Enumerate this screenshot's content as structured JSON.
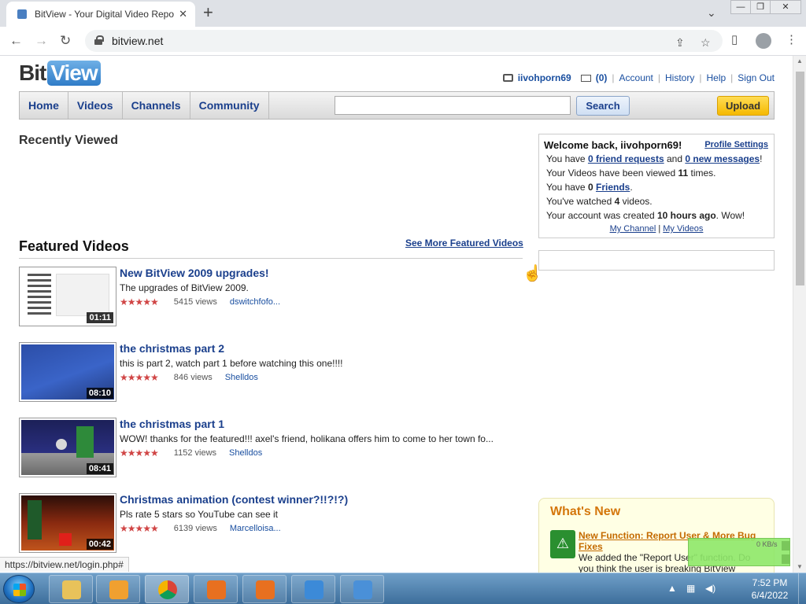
{
  "browser": {
    "tab_title": "BitView - Your Digital Video Repository",
    "url": "bitview.net",
    "status_url": "https://bitview.net/login.php#"
  },
  "site": {
    "logo_bit": "Bit",
    "logo_view": "View",
    "username": "iivohporn69",
    "message_count": "(0)",
    "user_links": [
      "Account",
      "History",
      "Help",
      "Sign Out"
    ],
    "nav": [
      "Home",
      "Videos",
      "Channels",
      "Community"
    ],
    "search_label": "Search",
    "upload_label": "Upload"
  },
  "recently_viewed": {
    "heading": "Recently Viewed"
  },
  "featured": {
    "heading": "Featured Videos",
    "see_more": "See More Featured Videos",
    "videos": [
      {
        "title": "New BitView 2009 upgrades!",
        "description": "The upgrades of BitView 2009.",
        "views": "5415 views",
        "author": "dswitchfofo...",
        "duration": "01:11",
        "rating": 4.5
      },
      {
        "title": "the christmas part 2",
        "description": "this is part 2, watch part 1 before watching this one!!!!",
        "views": "846 views",
        "author": "Shelldos",
        "duration": "08:10",
        "rating": 4.5
      },
      {
        "title": "the christmas part 1",
        "description": "WOW! thanks for the featured!!! axel's friend, holikana offers him to come to her town fo...",
        "views": "1152 views",
        "author": "Shelldos",
        "duration": "08:41",
        "rating": 4.5
      },
      {
        "title": "Christmas animation (contest winner?!!?!?)",
        "description": "Pls rate 5 stars so YouTube can see it",
        "views": "6139 views",
        "author": "Marcelloisa...",
        "duration": "00:42",
        "rating": 4.5
      }
    ]
  },
  "welcome_box": {
    "title": "Welcome back, iivohporn69!",
    "profile_settings": "Profile Settings",
    "line1_pre": "You have ",
    "friend_requests": "0 friend requests",
    "line1_mid": " and ",
    "new_messages": "0 new messages",
    "line1_post": "!",
    "line2_pre": "Your Videos have been viewed ",
    "line2_num": "11",
    "line2_post": " times.",
    "line3_pre": "You have ",
    "line3_num": "0",
    "line3_link": "Friends",
    "line3_post": ".",
    "line4_pre": "You've watched ",
    "line4_num": "4",
    "line4_post": " videos.",
    "line5_pre": "Your account was created ",
    "line5_bold": "10 hours ago",
    "line5_post": ". Wow!",
    "my_channel": "My Channel",
    "link_sep": "|",
    "my_videos": "My Videos"
  },
  "whats_new": {
    "heading": "What's New",
    "item_title": "New Function: Report User & More Bug Fixes",
    "item_text": "We added the \"Report User\" function. Do you think the user is breaking BitView"
  },
  "net_widget": {
    "speed": "0 KB/s"
  },
  "taskbar": {
    "time": "7:52 PM",
    "date": "6/4/2022"
  },
  "colors": {
    "nav_text": "#1a3f8c",
    "upload": "#f5b900",
    "whats_new_heading": "#d4760b",
    "star": "#d04545"
  }
}
